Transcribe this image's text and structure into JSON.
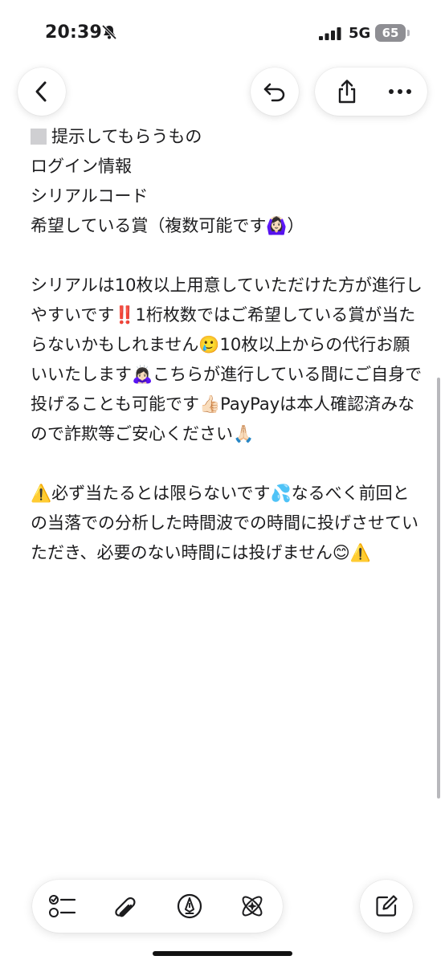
{
  "status_bar": {
    "time": "20:39",
    "network": "5G",
    "battery": "65"
  },
  "icons": {
    "back": "chevron-left-icon",
    "undo": "undo-icon",
    "share": "share-icon",
    "more": "ellipsis-icon",
    "checklist": "checklist-icon",
    "attachment": "paperclip-icon",
    "markup": "pen-circle-icon",
    "ai_tools": "sparkle-atom-icon",
    "compose": "compose-icon"
  },
  "note": {
    "lines": [
      "提示してもらうもの",
      "ログイン情報",
      "シリアルコード",
      "希望している賞（複数可能です🙆🏻‍♀️）"
    ],
    "paragraph_2": "シリアルは10枚以上用意していただけた方が進行しやすいです‼️1桁枚数ではご希望している賞が当たらないかもしれません🥲10枚以上からの代行お願いいたします🙇🏻‍♀️こちらが進行している間にご自身で投げることも可能です👍🏻PayPayは本人確認済みなので詐欺等ご安心ください🙏🏻",
    "paragraph_3": "⚠️必ず当たるとは限らないです💦なるべく前回との当落での分析した時間波での時間に投げさせていただき、必要のない時間には投げません😊⚠️"
  },
  "colors": {
    "background": "#ffffff",
    "text": "#1c1c1e",
    "icon": "#1c1c1e",
    "scrollbar": "#b8b8bc"
  }
}
